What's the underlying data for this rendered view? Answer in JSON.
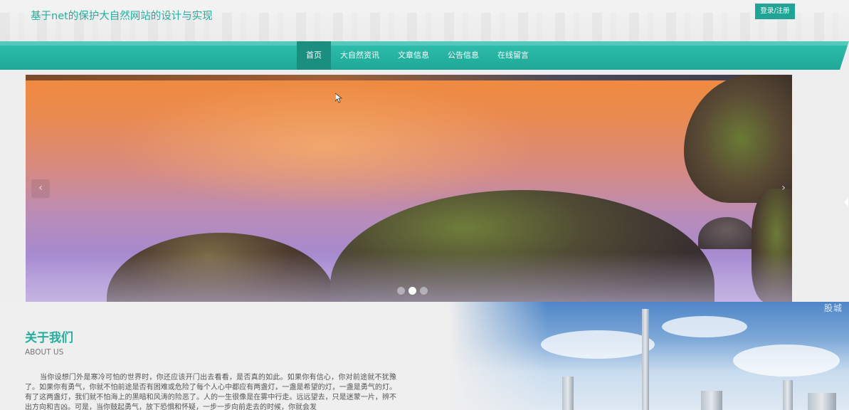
{
  "header": {
    "site_title": "基于net的保护大自然网站的设计与实现",
    "login_label": "登录/注册"
  },
  "nav": {
    "items": [
      {
        "label": "首页",
        "active": true
      },
      {
        "label": "大自然资讯",
        "active": false
      },
      {
        "label": "文章信息",
        "active": false
      },
      {
        "label": "公告信息",
        "active": false
      },
      {
        "label": "在线留言",
        "active": false
      }
    ]
  },
  "slider": {
    "prev_icon": "‹",
    "next_icon": "›",
    "slide_count": 3,
    "active_index": 1
  },
  "about": {
    "title": "关于我们",
    "subtitle": "ABOUT US",
    "watermark": "股城",
    "body": "当你设想门外是寒冷可怕的世界时，你还应该开门出去看看，是否真的如此。如果你有信心，你对前途就不犹豫了。如果你有勇气，你就不怕前途是否有困难或危险了每个人心中都应有两盏灯，一盏是希望的灯，一盏是勇气的灯。有了这两盏灯，我们就不怕海上的黑暗和风涛的险恶了。人的一生很像是在雾中行走。远远望去，只是迷蒙一片，辨不出方向和吉凶。可是，当你鼓起勇气，放下恐惧和怀疑，一步一步向前走去的时候，你就会发"
  },
  "colors": {
    "brand": "#21b0a0",
    "nav_active": "#1a8f80",
    "button": "#1fa595"
  }
}
